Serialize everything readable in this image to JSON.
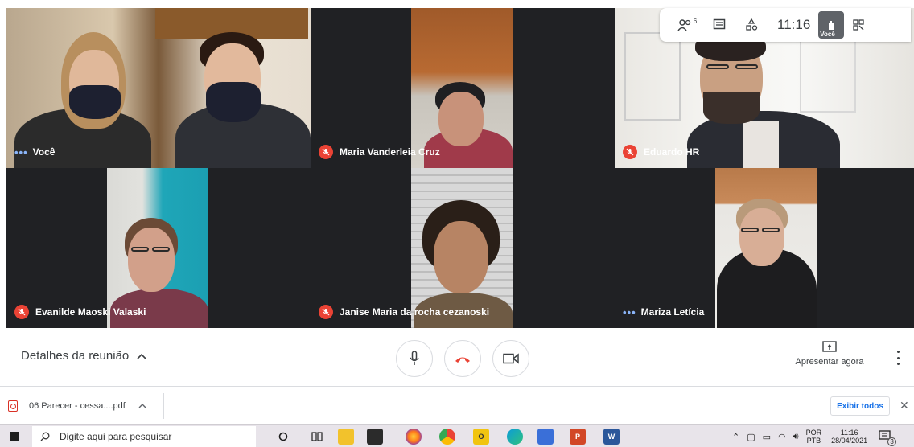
{
  "participants": [
    {
      "name": "Você",
      "status": "speaking"
    },
    {
      "name": "Maria Vanderleia Cruz",
      "status": "muted"
    },
    {
      "name": "Eduardo HR",
      "status": "muted"
    },
    {
      "name": "Evanilde Maoski Valaski",
      "status": "muted"
    },
    {
      "name": "Janise Maria da rocha cezanoski",
      "status": "muted"
    },
    {
      "name": "Mariza Letícia",
      "status": "speaking"
    }
  ],
  "top_bar": {
    "participant_count": "6",
    "clock": "11:16",
    "self_label": "Você",
    "icons": [
      "people-icon",
      "chat-icon",
      "activities-icon",
      "hand-icon",
      "grid-icon"
    ]
  },
  "controls": {
    "meeting_details_label": "Detalhes da reunião",
    "present_now_label": "Apresentar agora",
    "colors": {
      "hangup": "#ea4335",
      "muted": "#ea4335",
      "speaking_dots": "#8ab4f8"
    }
  },
  "downloads": {
    "file_name": "06 Parecer - cessa....pdf",
    "show_all_label": "Exibir todos"
  },
  "taskbar": {
    "search_placeholder": "Digite aqui para pesquisar",
    "language_top": "POR",
    "language_bottom": "PTB",
    "time": "11:16",
    "date": "28/04/2021",
    "notification_count": "3",
    "apps": [
      "cortana-icon",
      "task-view-icon",
      "file-explorer-icon",
      "store-icon",
      "firefox-icon",
      "chrome-icon",
      "outlook-icon",
      "edge-icon",
      "app-icon",
      "powerpoint-icon",
      "word-icon"
    ]
  }
}
